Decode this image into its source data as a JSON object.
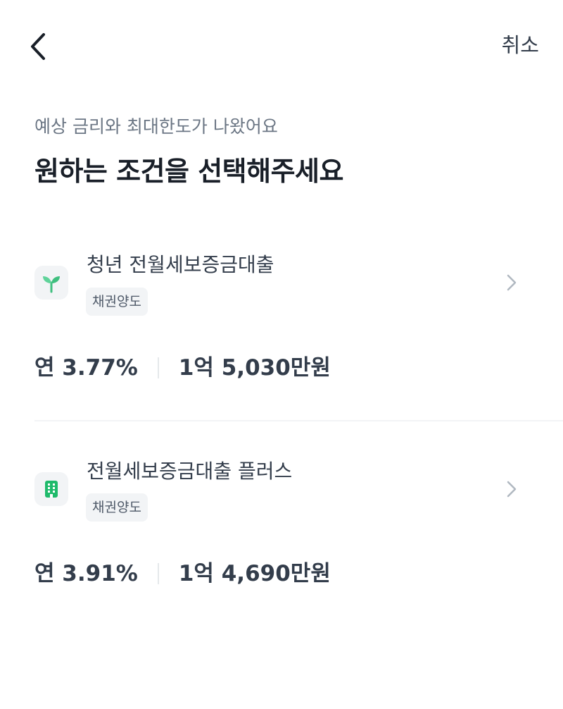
{
  "header": {
    "back_icon": "chevron-left-icon",
    "cancel_label": "취소"
  },
  "intro": {
    "subtitle": "예상 금리와 최대한도가 나왔어요",
    "title": "원하는 조건을 선택해주세요"
  },
  "products": [
    {
      "name": "청년 전월세보증금대출",
      "tag": "채권양도",
      "icon": "sprout-icon",
      "icon_color": "#3fbf7f",
      "rate": "연 3.77%",
      "limit": "1억 5,030만원"
    },
    {
      "name": "전월세보증금대출 플러스",
      "tag": "채권양도",
      "icon": "building-icon",
      "icon_color": "#1fba6b",
      "rate": "연 3.91%",
      "limit": "1억 4,690만원"
    }
  ],
  "colors": {
    "text_primary": "#191f28",
    "text_secondary": "#6b7684",
    "tag_background": "#f2f4f6",
    "chevron": "#b0b8c1"
  }
}
